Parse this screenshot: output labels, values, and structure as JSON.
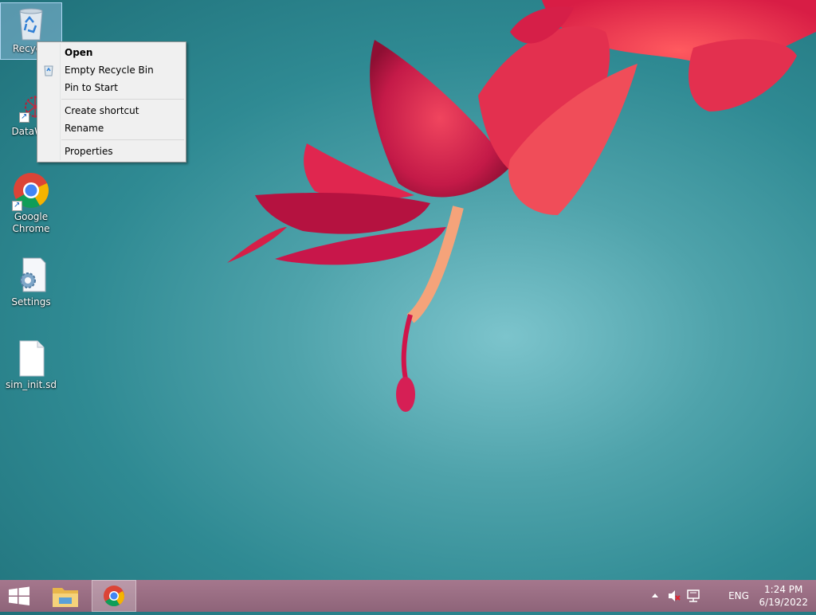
{
  "desktop": {
    "icons": [
      {
        "label": "Recycle",
        "icon": "recycle-bin-icon"
      },
      {
        "label": "DataWa",
        "icon": "datawarrior-icon"
      },
      {
        "label": "Google Chrome",
        "icon": "chrome-icon"
      },
      {
        "label": "Settings",
        "icon": "settings-icon"
      },
      {
        "label": "sim_init.sd",
        "icon": "file-icon"
      }
    ]
  },
  "context_menu": {
    "items": [
      {
        "label": "Open",
        "bold": true
      },
      {
        "label": "Empty Recycle Bin",
        "icon": "recycle-bin-icon"
      },
      {
        "label": "Pin to Start"
      },
      {
        "label": "Create shortcut"
      },
      {
        "label": "Rename"
      },
      {
        "label": "Properties"
      }
    ]
  },
  "taskbar": {
    "start_icon": "windows-logo-icon",
    "pinned": [
      {
        "icon": "file-explorer-icon"
      },
      {
        "icon": "chrome-icon",
        "active": true
      }
    ],
    "tray": {
      "chevron": "chevron-up-icon",
      "volume": "volume-muted-icon",
      "network": "network-icon",
      "language": "ENG"
    },
    "clock": {
      "time": "1:24 PM",
      "date": "6/19/2022"
    }
  },
  "colors": {
    "taskbar": "#8e6479",
    "menu_bg": "#f0f0f0",
    "selection": "#a0c8eb"
  }
}
